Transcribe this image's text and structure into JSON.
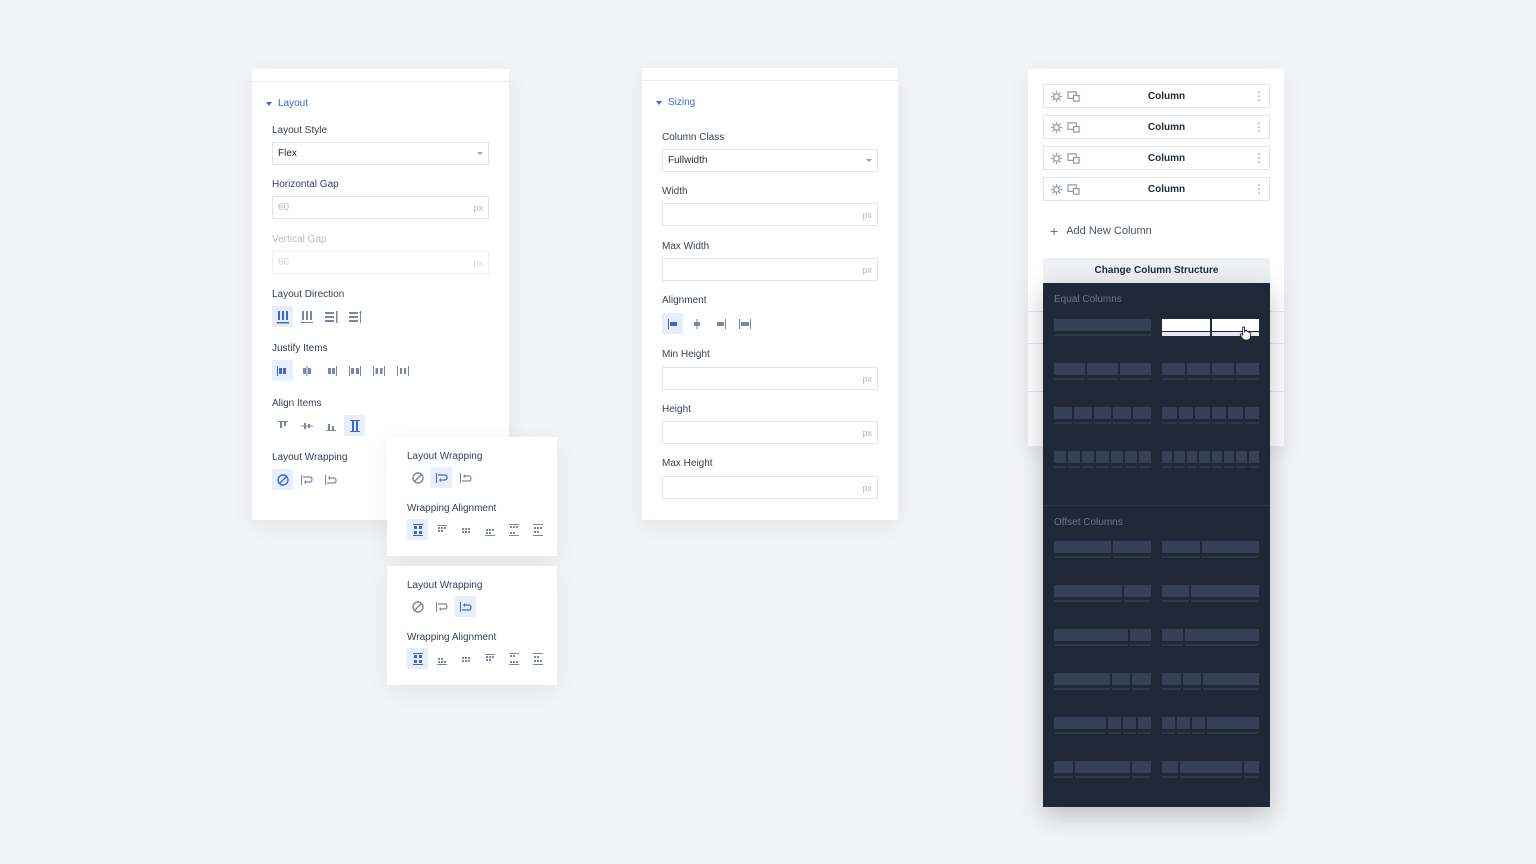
{
  "layout_panel": {
    "section_title": "Layout",
    "layout_style": {
      "label": "Layout Style",
      "value": "Flex"
    },
    "horizontal_gap": {
      "label": "Horizontal Gap",
      "placeholder": "60",
      "unit": "px"
    },
    "vertical_gap": {
      "label": "Vertical Gap",
      "placeholder": "60",
      "unit": "px"
    },
    "layout_direction": {
      "label": "Layout Direction"
    },
    "justify_items": {
      "label": "Justify Items"
    },
    "align_items": {
      "label": "Align Items"
    },
    "layout_wrapping": {
      "label": "Layout Wrapping"
    }
  },
  "wrap_popup_1": {
    "layout_wrapping": "Layout Wrapping",
    "wrapping_alignment": "Wrapping Alignment"
  },
  "wrap_popup_2": {
    "layout_wrapping": "Layout Wrapping",
    "wrapping_alignment": "Wrapping Alignment"
  },
  "sizing_panel": {
    "section_title": "Sizing",
    "column_class": {
      "label": "Column Class",
      "value": "Fullwidth"
    },
    "width": {
      "label": "Width",
      "unit": "px"
    },
    "max_width": {
      "label": "Max Width",
      "unit": "px"
    },
    "alignment": {
      "label": "Alignment"
    },
    "min_height": {
      "label": "Min Height",
      "unit": "px"
    },
    "height": {
      "label": "Height",
      "unit": "px"
    },
    "max_height": {
      "label": "Max Height",
      "unit": "px"
    }
  },
  "column_panel": {
    "columns": [
      "Column",
      "Column",
      "Column",
      "Column"
    ],
    "add_new": "Add New Column",
    "change_structure": "Change Column Structure",
    "equal_columns": "Equal Columns",
    "offset_columns": "Offset Columns"
  },
  "colors": {
    "accent": "#3b67d8",
    "dark_panel": "#1e2837",
    "block": "#344157"
  }
}
